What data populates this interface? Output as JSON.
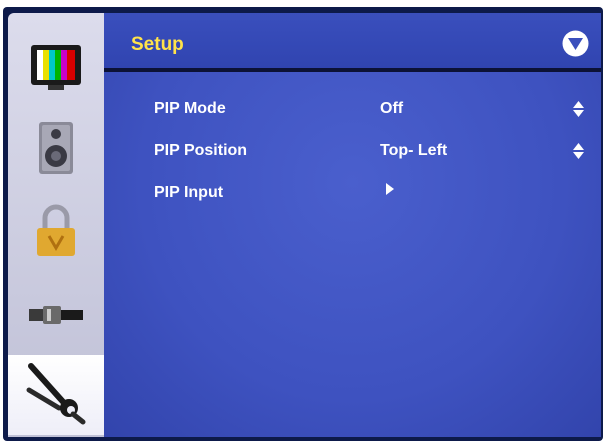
{
  "title": "Setup",
  "menu": {
    "items": [
      {
        "label": "PIP Mode",
        "value": "Off",
        "control": "up-down-arrows"
      },
      {
        "label": "PIP Position",
        "value": "Top- Left",
        "control": "up-down-arrows"
      },
      {
        "label": "PIP Input",
        "value": "",
        "control": "submenu-arrow"
      }
    ]
  },
  "sidebar": {
    "items": [
      {
        "icon": "tv-picture-icon",
        "selected": false
      },
      {
        "icon": "speaker-icon",
        "selected": false
      },
      {
        "icon": "padlock-icon",
        "selected": false
      },
      {
        "icon": "cable-connector-icon",
        "selected": false
      },
      {
        "icon": "wrench-pliers-icon",
        "selected": true
      }
    ]
  },
  "colors": {
    "panel": "#3e52c0",
    "title": "#ffe34a",
    "text": "#ffffff",
    "sidebar": "#cfd0e2"
  }
}
